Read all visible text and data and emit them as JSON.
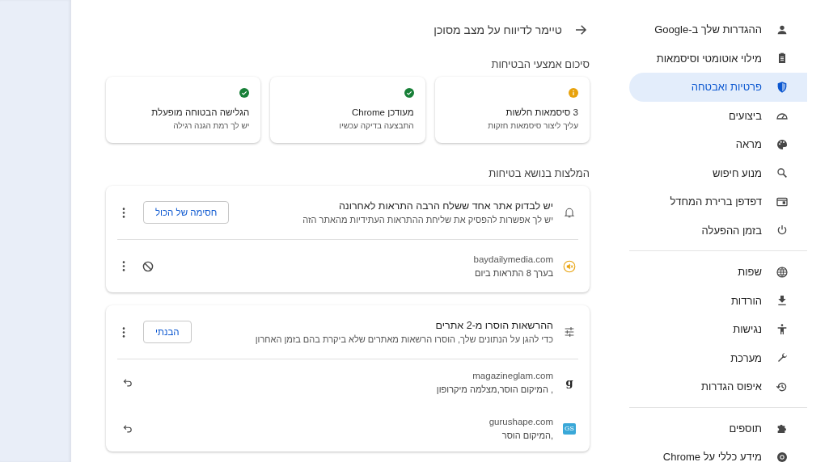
{
  "sidebar": {
    "groups": [
      [
        {
          "label": "ההגדרות שלך ב-Google",
          "selected": false
        },
        {
          "label": "מילוי אוטומטי וסיסמאות",
          "selected": false
        },
        {
          "label": "פרטיות ואבטחה",
          "selected": true
        },
        {
          "label": "ביצועים",
          "selected": false
        },
        {
          "label": "מראה",
          "selected": false
        },
        {
          "label": "מנוע חיפוש",
          "selected": false
        },
        {
          "label": "דפדפן ברירת המחדל",
          "selected": false
        },
        {
          "label": "בזמן ההפעלה",
          "selected": false
        }
      ],
      [
        {
          "label": "שפות",
          "selected": false
        },
        {
          "label": "הורדות",
          "selected": false
        },
        {
          "label": "נגישות",
          "selected": false
        },
        {
          "label": "מערכת",
          "selected": false
        },
        {
          "label": "איפוס הגדרות",
          "selected": false
        }
      ],
      [
        {
          "label": "תוספים",
          "selected": false
        },
        {
          "label": "מידע כללי על Chrome",
          "selected": false
        }
      ]
    ]
  },
  "main": {
    "back_link": {
      "label": "טיימר לדיווח על מצב מסוכן"
    },
    "summary": {
      "title": "סיכום אמצעי הבטיחות",
      "cards": [
        {
          "kind": "warning",
          "title": "3 סיסמאות חלשות",
          "subtitle": "עליך ליצור סיסמאות חזקות"
        },
        {
          "kind": "ok",
          "title": "מעודכן Chrome",
          "subtitle": "התבצעה בדיקה עכשיו"
        },
        {
          "kind": "ok",
          "title": "הגלישה הבטוחה מופעלת",
          "subtitle": "יש לך רמת הגנה רגילה"
        }
      ]
    },
    "recommendations": {
      "title": "המלצות בנושא בטיחות",
      "panels": [
        {
          "kind": "notifications",
          "title": "יש לבדוק אתר אחד ששלח הרבה התראות לאחרונה",
          "description": "יש לך אפשרות להפסיק את שליחת ההתראות העתידיות מהאתר הזה",
          "button": "חסימה של הכול",
          "sites": [
            {
              "domain": "baydailymedia.com",
              "detail": "בערך 8 התראות ביום"
            }
          ]
        },
        {
          "kind": "permissions",
          "title": "ההרשאות הוסרו מ-2 אתרים",
          "description": "כדי להגן על הנתונים שלך, הוסרו הרשאות מאתרים שלא ביקרת בהם בזמן האחרון",
          "button": "הבנתי",
          "sites": [
            {
              "domain": "magazineglam.com",
              "detail": ", המיקום הוסר,מצלמה  מיקרופון",
              "favicon": "g"
            },
            {
              "domain": "gurushape.com",
              "detail": ",המיקום הוסר",
              "favicon": "GS"
            }
          ]
        }
      ]
    }
  }
}
